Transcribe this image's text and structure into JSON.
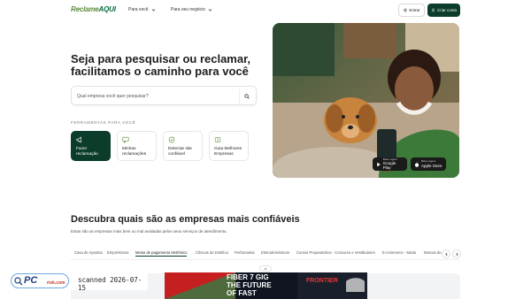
{
  "header": {
    "logo_part1": "Reclame",
    "logo_part2": "AQUI",
    "nav_for_you": "Para você",
    "nav_business": "Para seu negócio",
    "enter_label": "Entrar",
    "create_label": "Criar conta"
  },
  "hero": {
    "title": "Seja para pesquisar ou reclamar, facilitamos o caminho para você",
    "search_placeholder": "Qual empresa você quer pesquisar?",
    "tools_label": "FERRAMENTAS PARA VOCÊ",
    "tools": [
      {
        "label": "Fazer reclamação",
        "icon": "megaphone-icon"
      },
      {
        "label": "Minhas reclamações",
        "icon": "chat-icon"
      },
      {
        "label": "Detectar site confiável",
        "icon": "shield-check-icon"
      },
      {
        "label": "Guia Melhores Empresas",
        "icon": "book-icon"
      }
    ],
    "store_google_small": "Baixe agora",
    "store_google": "Google Play",
    "store_apple_small": "Baixe agora",
    "store_apple": "Apple Store"
  },
  "rankings": {
    "title": "Descubra quais são as empresas mais confiáveis",
    "subtitle": "Estas são as empresas mais bem ou mal avaliadas pelos seus serviços de atendimento.",
    "tabs": [
      "Casa de Apostas",
      "Empréstimos",
      "Meios de pagamento eletrônico",
      "Clínicas de Estética",
      "Perfumarias",
      "Eletrodomésticos",
      "Cursos Preparatórios - Concurso e Vestibulares",
      "E-commerce - Moda",
      "Marcas de"
    ],
    "active_tab": "Meios de pagamento eletrônico"
  },
  "watermark": {
    "pc": "PC",
    "risk": "risk.com",
    "text": "scanned 2026-07-15"
  },
  "ad": {
    "line1": "FIBER 7 GIG",
    "line2": "THE FUTURE",
    "line3": "OF FAST",
    "brand": "FRONTIER"
  },
  "colors": {
    "brand_dark": "#0b3d2a",
    "brand_green": "#5b8c3a",
    "accent_red": "#d32f2f"
  }
}
